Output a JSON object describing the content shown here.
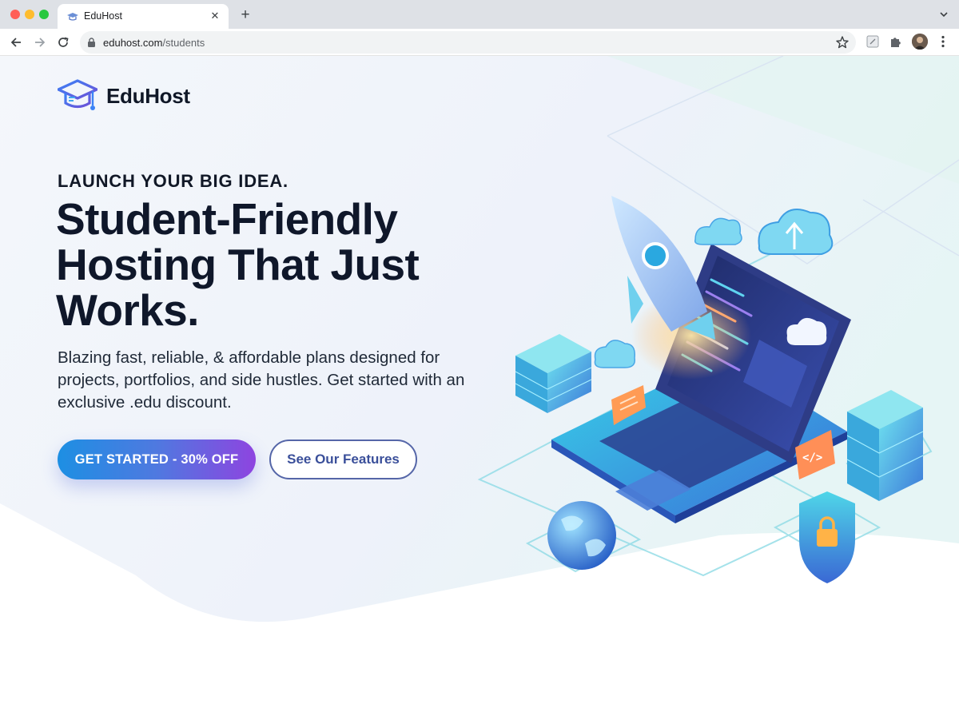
{
  "browser": {
    "tab_title": "EduHost",
    "url_host": "eduhost.com",
    "url_path": "/students",
    "icons": [
      "close-icon",
      "plus-icon",
      "chevron-down-icon",
      "back-icon",
      "forward-icon",
      "reload-icon",
      "lock-icon",
      "star-icon",
      "extension-icon",
      "puzzle-icon",
      "menu-icon"
    ]
  },
  "logo": {
    "text": "EduHost",
    "icon": "graduation-cap-icon"
  },
  "hero": {
    "eyebrow": "LAUNCH YOUR BIG IDEA.",
    "headline": "Student-Friendly Hosting That Just Works.",
    "lead": "Blazing fast, reliable, & affordable plans designed for projects, portfolios, and side hustles. Get started with an exclusive .edu discount.",
    "primary_cta": "GET STARTED - 30% OFF",
    "secondary_cta": "See Our Features"
  },
  "illustration_code_glyph": "</>",
  "colors": {
    "brand_blue": "#1d8fe3",
    "brand_purple": "#8e44e0",
    "outline_button": "#5566a8",
    "headline": "#0f172a"
  }
}
